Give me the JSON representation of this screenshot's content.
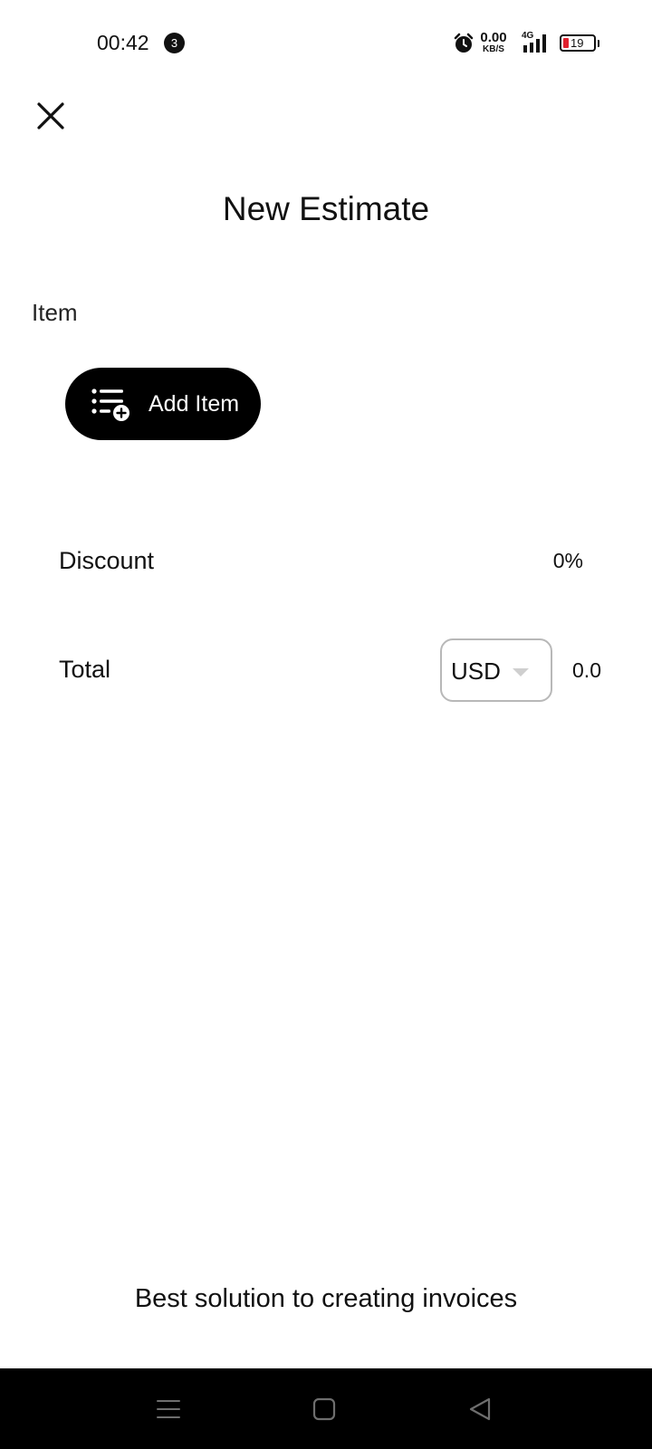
{
  "status_bar": {
    "time": "00:42",
    "notification_count": "3",
    "net_speed_value": "0.00",
    "net_speed_unit": "KB/S",
    "network_type": "4G",
    "battery_level": "19",
    "battery_color": "#e0212e",
    "icons": [
      "alarm-icon",
      "signal-icon",
      "battery-icon"
    ]
  },
  "header": {
    "close_icon": "close-icon",
    "title": "New Estimate"
  },
  "item_section": {
    "label": "Item",
    "add_button": {
      "icon": "list-add-icon",
      "label": "Add Item"
    }
  },
  "discount": {
    "label": "Discount",
    "value": "0%"
  },
  "total": {
    "label": "Total",
    "currency": "USD",
    "value": "0.0"
  },
  "footer": {
    "tagline": "Best solution to creating invoices"
  },
  "nav_bar": {
    "buttons": [
      "menu-icon",
      "home-icon",
      "back-icon"
    ]
  }
}
